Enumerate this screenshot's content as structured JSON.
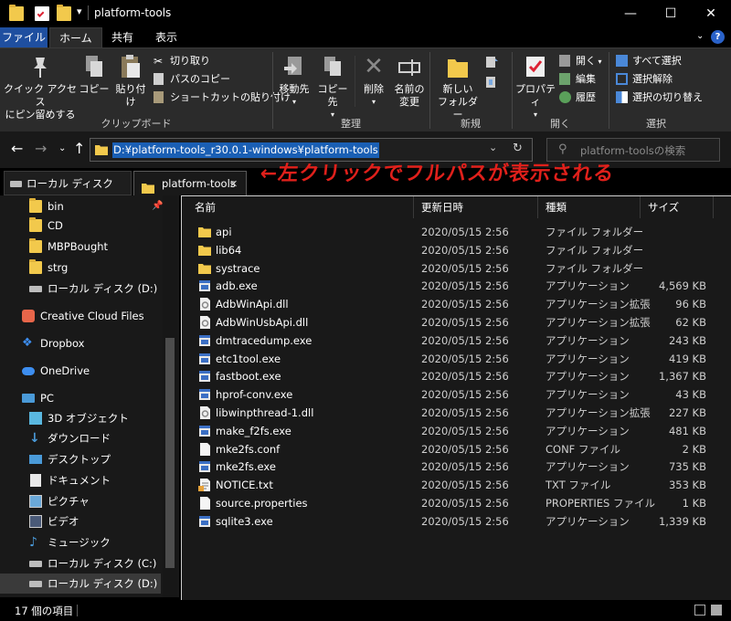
{
  "window": {
    "title": "platform-tools",
    "minimize": "—",
    "maximize": "☐",
    "close": "✕",
    "qa_dropdown": "▾"
  },
  "ribbon_tabs": {
    "file": "ファイル",
    "home": "ホーム",
    "share": "共有",
    "view": "表示",
    "help": "?"
  },
  "ribbon": {
    "clipboard": {
      "pin": "クイック アクセス\nにピン留めする",
      "copy": "コピー",
      "paste": "貼り付け",
      "cut": "切り取り",
      "copy_path": "パスのコピー",
      "paste_shortcut": "ショートカットの貼り付け",
      "label": "クリップボード"
    },
    "organize": {
      "move_to": "移動先",
      "copy_to": "コピー先",
      "delete": "削除",
      "rename": "名前の\n変更",
      "label": "整理"
    },
    "new": {
      "new_folder": "新しい\nフォルダー",
      "label": "新規"
    },
    "open": {
      "properties": "プロパティ",
      "open": "開く",
      "edit": "編集",
      "history": "履歴",
      "label": "開く"
    },
    "select": {
      "select_all": "すべて選択",
      "select_none": "選択解除",
      "invert": "選択の切り替え",
      "label": "選択"
    }
  },
  "address": {
    "path": "D:¥platform-tools_r30.0.1-windows¥platform-tools",
    "search_placeholder": "platform-toolsの検索"
  },
  "doc_tabs": [
    {
      "label": "ローカル ディスク (D:)"
    },
    {
      "label": "platform-tools"
    }
  ],
  "annotation": "←左クリックでフルパスが表示される",
  "nav": {
    "items": [
      {
        "label": "bin"
      },
      {
        "label": "CD"
      },
      {
        "label": "MBPBought"
      },
      {
        "label": "strg"
      },
      {
        "label": "ローカル ディスク (D:)"
      },
      {
        "label": "Creative Cloud Files"
      },
      {
        "label": "Dropbox"
      },
      {
        "label": "OneDrive"
      },
      {
        "label": "PC"
      },
      {
        "label": "3D オブジェクト"
      },
      {
        "label": "ダウンロード"
      },
      {
        "label": "デスクトップ"
      },
      {
        "label": "ドキュメント"
      },
      {
        "label": "ピクチャ"
      },
      {
        "label": "ビデオ"
      },
      {
        "label": "ミュージック"
      },
      {
        "label": "ローカル ディスク (C:)"
      },
      {
        "label": "ローカル ディスク (D:)"
      }
    ]
  },
  "columns": {
    "name": "名前",
    "modified": "更新日時",
    "type": "種類",
    "size": "サイズ"
  },
  "files": [
    {
      "name": "api",
      "date": "2020/05/15 2:56",
      "type": "ファイル フォルダー",
      "size": "",
      "icon": "folder-icon"
    },
    {
      "name": "lib64",
      "date": "2020/05/15 2:56",
      "type": "ファイル フォルダー",
      "size": "",
      "icon": "folder-icon"
    },
    {
      "name": "systrace",
      "date": "2020/05/15 2:56",
      "type": "ファイル フォルダー",
      "size": "",
      "icon": "folder-icon"
    },
    {
      "name": "adb.exe",
      "date": "2020/05/15 2:56",
      "type": "アプリケーション",
      "size": "4,569 KB",
      "icon": "exe-icon"
    },
    {
      "name": "AdbWinApi.dll",
      "date": "2020/05/15 2:56",
      "type": "アプリケーション拡張",
      "size": "96 KB",
      "icon": "dll-icon"
    },
    {
      "name": "AdbWinUsbApi.dll",
      "date": "2020/05/15 2:56",
      "type": "アプリケーション拡張",
      "size": "62 KB",
      "icon": "dll-icon"
    },
    {
      "name": "dmtracedump.exe",
      "date": "2020/05/15 2:56",
      "type": "アプリケーション",
      "size": "243 KB",
      "icon": "exe-icon"
    },
    {
      "name": "etc1tool.exe",
      "date": "2020/05/15 2:56",
      "type": "アプリケーション",
      "size": "419 KB",
      "icon": "exe-icon"
    },
    {
      "name": "fastboot.exe",
      "date": "2020/05/15 2:56",
      "type": "アプリケーション",
      "size": "1,367 KB",
      "icon": "exe-icon"
    },
    {
      "name": "hprof-conv.exe",
      "date": "2020/05/15 2:56",
      "type": "アプリケーション",
      "size": "43 KB",
      "icon": "exe-icon"
    },
    {
      "name": "libwinpthread-1.dll",
      "date": "2020/05/15 2:56",
      "type": "アプリケーション拡張",
      "size": "227 KB",
      "icon": "dll-icon"
    },
    {
      "name": "make_f2fs.exe",
      "date": "2020/05/15 2:56",
      "type": "アプリケーション",
      "size": "481 KB",
      "icon": "exe-icon"
    },
    {
      "name": "mke2fs.conf",
      "date": "2020/05/15 2:56",
      "type": "CONF ファイル",
      "size": "2 KB",
      "icon": "file-icon"
    },
    {
      "name": "mke2fs.exe",
      "date": "2020/05/15 2:56",
      "type": "アプリケーション",
      "size": "735 KB",
      "icon": "exe-icon"
    },
    {
      "name": "NOTICE.txt",
      "date": "2020/05/15 2:56",
      "type": "TXT ファイル",
      "size": "353 KB",
      "icon": "txt-icon"
    },
    {
      "name": "source.properties",
      "date": "2020/05/15 2:56",
      "type": "PROPERTIES ファイル",
      "size": "1 KB",
      "icon": "file-icon"
    },
    {
      "name": "sqlite3.exe",
      "date": "2020/05/15 2:56",
      "type": "アプリケーション",
      "size": "1,339 KB",
      "icon": "exe-icon"
    }
  ],
  "status": {
    "count": "17 個の項目"
  },
  "colors": {
    "accent": "#1a5fb4",
    "annotation": "#e0201b",
    "folder": "#f2c94c"
  }
}
